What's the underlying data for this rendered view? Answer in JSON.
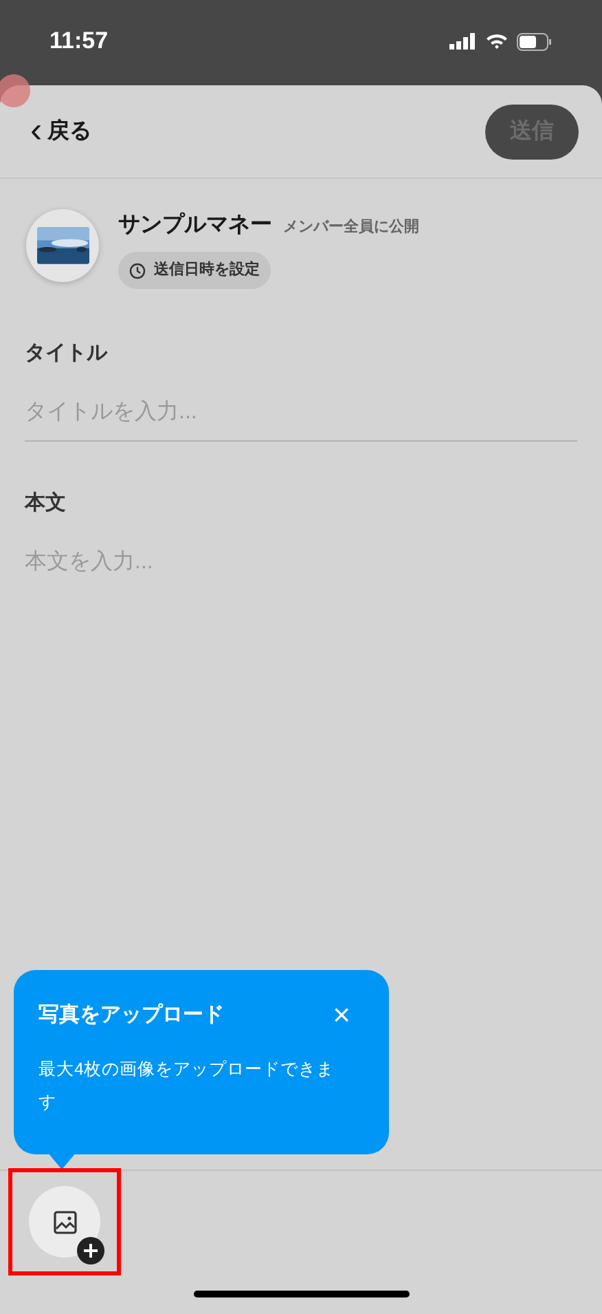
{
  "status_bar": {
    "time": "11:57"
  },
  "header": {
    "back": {
      "icon": "‹",
      "label": "戻る"
    },
    "send_button": {
      "label": "送信",
      "disabled": true
    }
  },
  "sender": {
    "name": "サンプルマネー",
    "audience": "メンバー全員に公開",
    "schedule_button": "送信日時を設定"
  },
  "fields": [
    {
      "label": "タイトル",
      "placeholder": "タイトルを入力...",
      "underline": true
    },
    {
      "label": "本文",
      "placeholder": "本文を入力...",
      "underline": false
    }
  ],
  "tooltip": {
    "title": "写真をアップロード",
    "close": "×",
    "message": "最大4枚の画像をアップロードできます"
  },
  "toolbar": {
    "upload_button": {
      "highlighted": true
    }
  }
}
